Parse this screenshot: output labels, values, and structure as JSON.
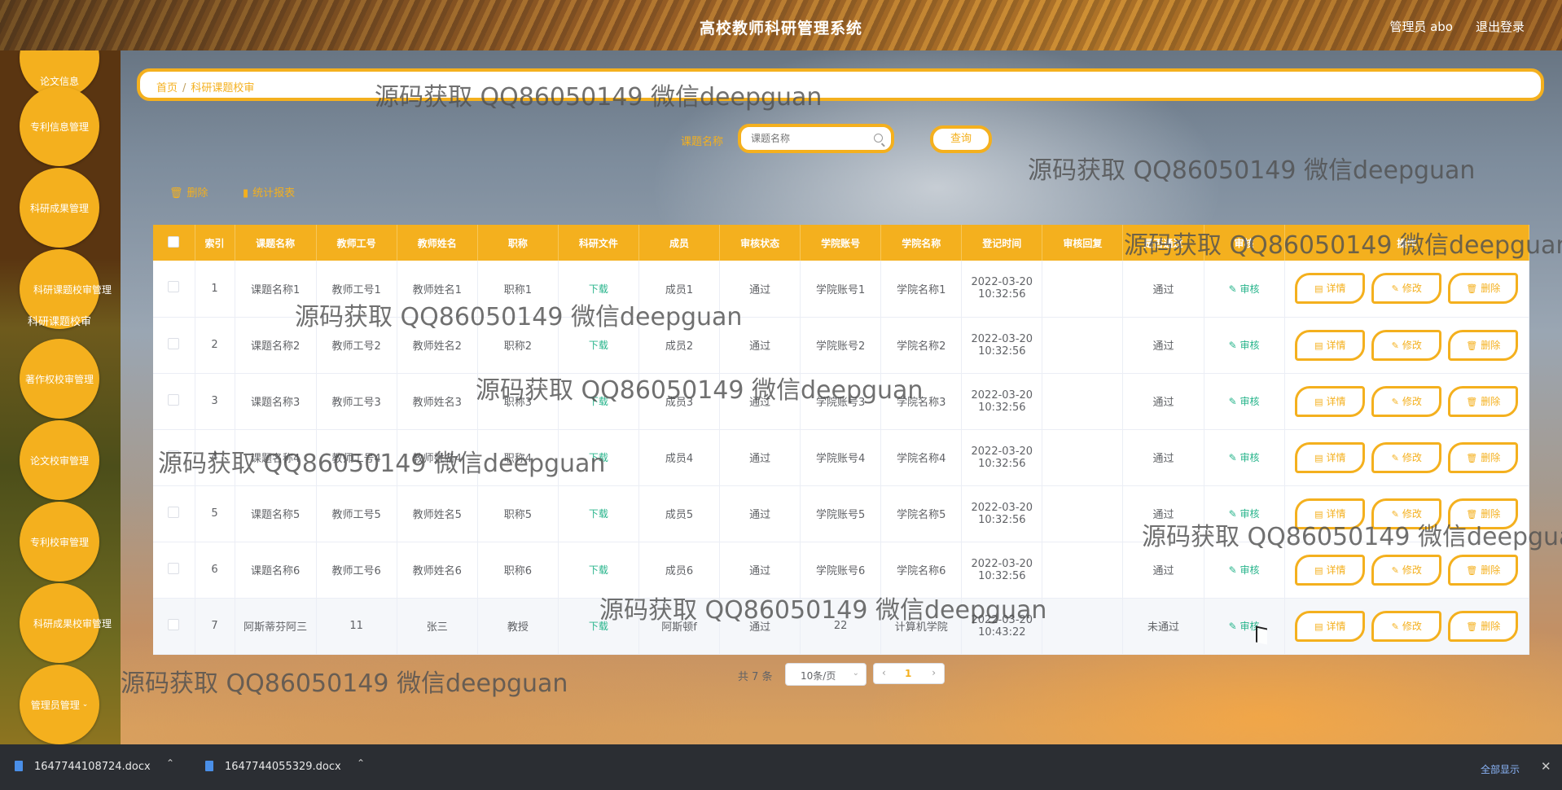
{
  "header": {
    "title": "高校教师科研管理系统",
    "user": "管理员 abo",
    "logout": "退出登录"
  },
  "sidebar": {
    "items": [
      {
        "label": "论文信息"
      },
      {
        "label": "专利信息管理"
      },
      {
        "label": "科研成果管理"
      },
      {
        "label": "科研课题校审管理"
      },
      {
        "label": "著作权校审管理"
      },
      {
        "label": "论文校审管理"
      },
      {
        "label": "专利校审管理"
      },
      {
        "label": "科研成果校审管理"
      },
      {
        "label": "管理员管理"
      }
    ],
    "sub_label": "科研课题校审"
  },
  "breadcrumb": {
    "home": "首页",
    "separator": "/",
    "current": "科研课题校审"
  },
  "search": {
    "label": "课题名称",
    "placeholder": "课题名称",
    "button": "查询"
  },
  "toolbar": {
    "delete": "删除",
    "report": "统计报表"
  },
  "table": {
    "headers": [
      "索引",
      "课题名称",
      "教师工号",
      "教师姓名",
      "职称",
      "科研文件",
      "成员",
      "审核状态",
      "学院账号",
      "学院名称",
      "登记时间",
      "审核回复",
      "是否通过",
      "审核",
      "操作"
    ],
    "download_label": "下载",
    "audit_label": "审核",
    "buttons": {
      "detail": "详情",
      "edit": "修改",
      "delete": "删除"
    },
    "rows": [
      {
        "index": "1",
        "name": "课题名称1",
        "tid": "教师工号1",
        "tname": "教师姓名1",
        "title": "职称1",
        "member": "成员1",
        "status": "通过",
        "acct": "学院账号1",
        "college": "学院名称1",
        "date": "2022-03-20",
        "time": "10:32:56",
        "reply": "",
        "pass": "通过"
      },
      {
        "index": "2",
        "name": "课题名称2",
        "tid": "教师工号2",
        "tname": "教师姓名2",
        "title": "职称2",
        "member": "成员2",
        "status": "通过",
        "acct": "学院账号2",
        "college": "学院名称2",
        "date": "2022-03-20",
        "time": "10:32:56",
        "reply": "",
        "pass": "通过"
      },
      {
        "index": "3",
        "name": "课题名称3",
        "tid": "教师工号3",
        "tname": "教师姓名3",
        "title": "职称3",
        "member": "成员3",
        "status": "通过",
        "acct": "学院账号3",
        "college": "学院名称3",
        "date": "2022-03-20",
        "time": "10:32:56",
        "reply": "",
        "pass": "通过"
      },
      {
        "index": "4",
        "name": "课题名称4",
        "tid": "教师工号4",
        "tname": "教师姓名4",
        "title": "职称4",
        "member": "成员4",
        "status": "通过",
        "acct": "学院账号4",
        "college": "学院名称4",
        "date": "2022-03-20",
        "time": "10:32:56",
        "reply": "",
        "pass": "通过"
      },
      {
        "index": "5",
        "name": "课题名称5",
        "tid": "教师工号5",
        "tname": "教师姓名5",
        "title": "职称5",
        "member": "成员5",
        "status": "通过",
        "acct": "学院账号5",
        "college": "学院名称5",
        "date": "2022-03-20",
        "time": "10:32:56",
        "reply": "",
        "pass": "通过"
      },
      {
        "index": "6",
        "name": "课题名称6",
        "tid": "教师工号6",
        "tname": "教师姓名6",
        "title": "职称6",
        "member": "成员6",
        "status": "通过",
        "acct": "学院账号6",
        "college": "学院名称6",
        "date": "2022-03-20",
        "time": "10:32:56",
        "reply": "",
        "pass": "通过"
      },
      {
        "index": "7",
        "name": "阿斯蒂芬阿三",
        "tid": "11",
        "tname": "张三",
        "title": "教授",
        "member": "阿斯顿f",
        "status": "通过",
        "acct": "22",
        "college": "计算机学院",
        "date": "2022-03-20",
        "time": "10:43:22",
        "reply": "",
        "pass": "未通过"
      }
    ]
  },
  "pagination": {
    "total": "共 7 条",
    "page_size": "10条/页",
    "current": "1",
    "prev": "‹",
    "next": "›"
  },
  "downloads": {
    "files": [
      "1647744108724.docx",
      "1647744055329.docx"
    ],
    "show_all": "全部显示",
    "close": "✕"
  },
  "watermark": "源码获取 QQ86050149 微信deepguan",
  "colors": {
    "accent": "#f4b01e",
    "link_green": "#27b48b"
  }
}
